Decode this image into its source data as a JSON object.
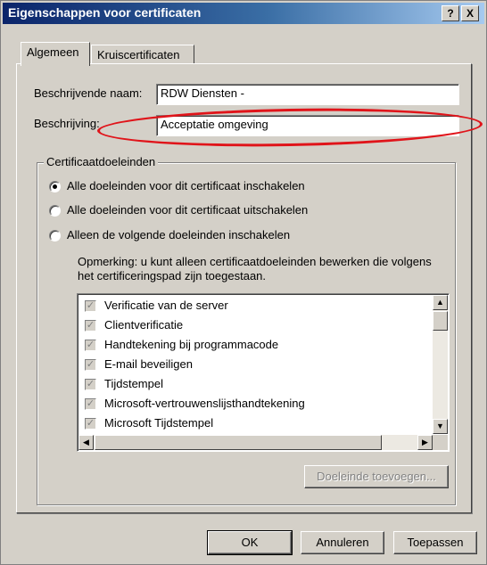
{
  "window": {
    "title": "Eigenschappen voor certificaten",
    "help_button": "?",
    "close_button": "X"
  },
  "tabs": [
    {
      "label": "Algemeen",
      "selected": true
    },
    {
      "label": "Kruiscertificaten",
      "selected": false
    }
  ],
  "general": {
    "friendly_name_label": "Beschrijvende naam:",
    "friendly_name_value": "RDW Diensten -",
    "description_label": "Beschrijving:",
    "description_value": "Acceptatie omgeving"
  },
  "purposes": {
    "group_title": "Certificaatdoeleinden",
    "options": [
      {
        "label": "Alle doeleinden voor dit certificaat inschakelen",
        "selected": true
      },
      {
        "label": "Alle doeleinden voor dit certificaat uitschakelen",
        "selected": false
      },
      {
        "label": "Alleen de volgende doeleinden inschakelen",
        "selected": false
      }
    ],
    "note": "Opmerking: u kunt alleen certificaatdoeleinden bewerken die volgens het certificeringspad zijn toegestaan.",
    "list": [
      {
        "label": "Verificatie van de server",
        "checked": true
      },
      {
        "label": "Clientverificatie",
        "checked": true
      },
      {
        "label": "Handtekening bij programmacode",
        "checked": true
      },
      {
        "label": "E-mail beveiligen",
        "checked": true
      },
      {
        "label": "Tijdstempel",
        "checked": true
      },
      {
        "label": "Microsoft-vertrouwenslijsthandtekening",
        "checked": true
      },
      {
        "label": "Microsoft Tijdstempel",
        "checked": true
      }
    ],
    "add_purpose_button": "Doeleinde toevoegen..."
  },
  "buttons": {
    "ok": "OK",
    "cancel": "Annuleren",
    "apply": "Toepassen"
  },
  "annotation": {
    "color": "#e0141a"
  }
}
